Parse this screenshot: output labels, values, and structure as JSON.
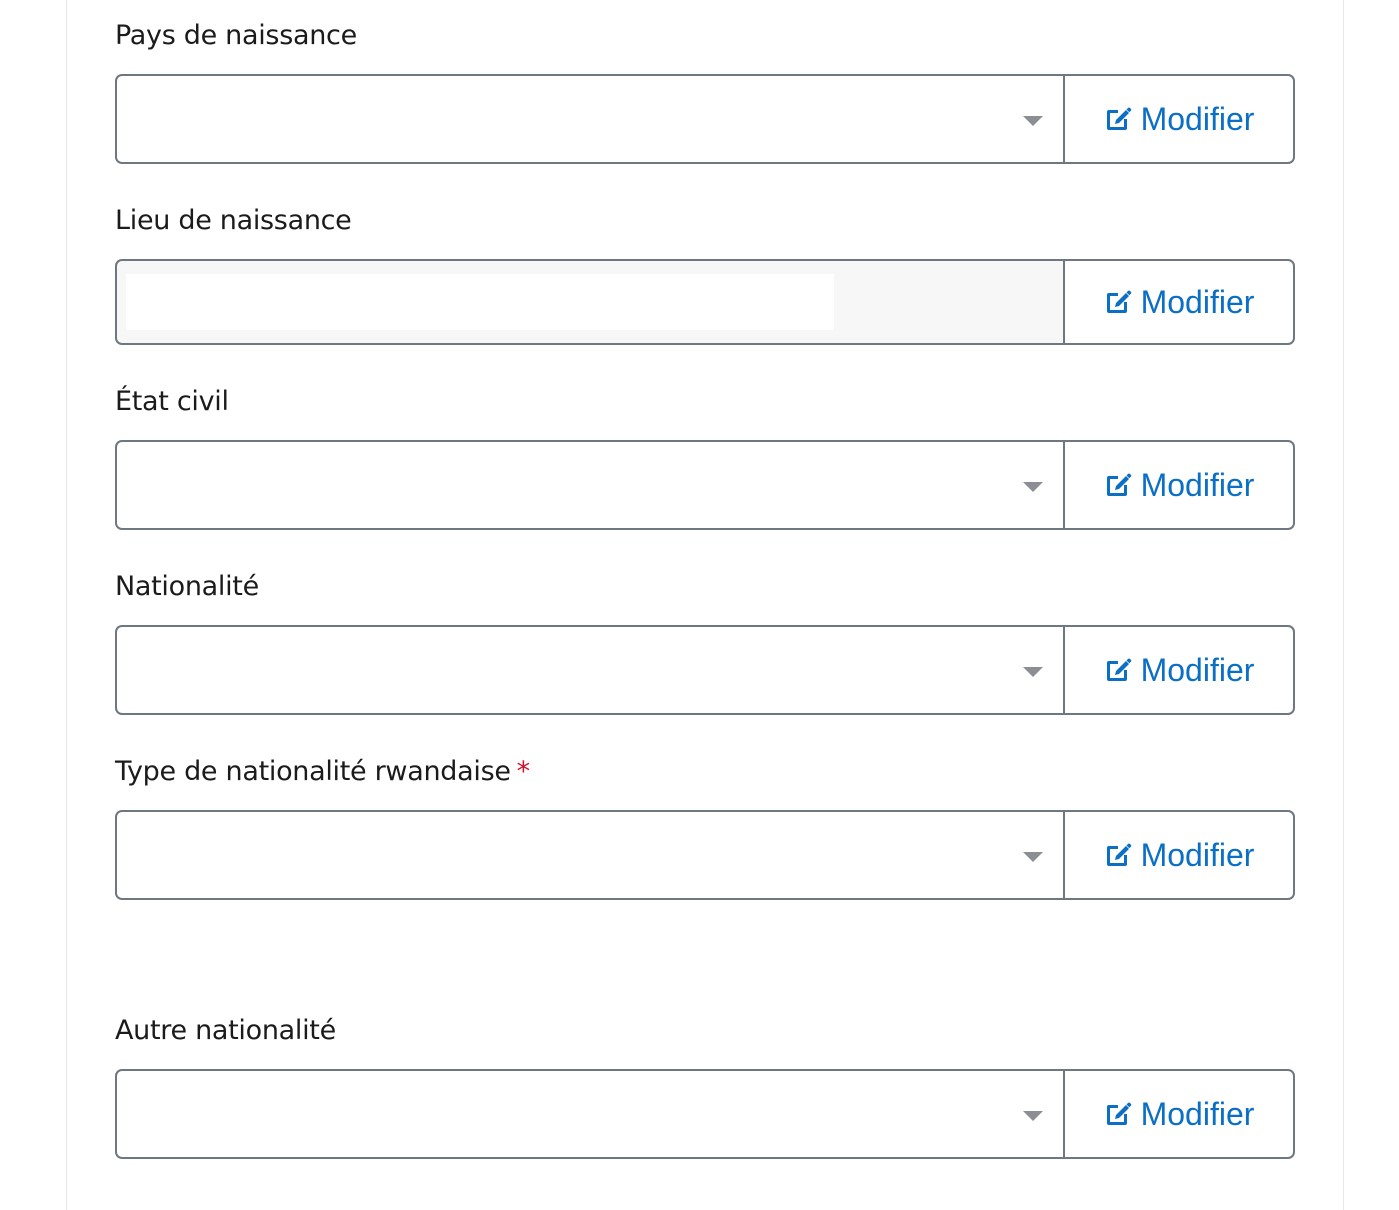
{
  "form": {
    "fields": [
      {
        "label": "Pays de naissance",
        "type": "select",
        "value": "",
        "required": false,
        "button": "Modifier"
      },
      {
        "label": "Lieu de naissance",
        "type": "text",
        "value": "",
        "required": false,
        "button": "Modifier"
      },
      {
        "label": "État civil",
        "type": "select",
        "value": "",
        "required": false,
        "button": "Modifier"
      },
      {
        "label": "Nationalité",
        "type": "select",
        "value": "",
        "required": false,
        "button": "Modifier"
      },
      {
        "label": "Type de nationalité rwandaise",
        "type": "select",
        "value": "",
        "required": true,
        "required_mark": "*",
        "button": "Modifier"
      },
      {
        "label": "Autre nationalité",
        "type": "select",
        "value": "",
        "required": false,
        "button": "Modifier"
      }
    ]
  },
  "icons": {
    "modify": "edit-square-pencil-icon",
    "dropdown": "caret-down-icon"
  },
  "colors": {
    "accent": "#0b6fc6",
    "required": "#d0112b",
    "border": "#6f7780",
    "text": "#1b1b1b"
  }
}
